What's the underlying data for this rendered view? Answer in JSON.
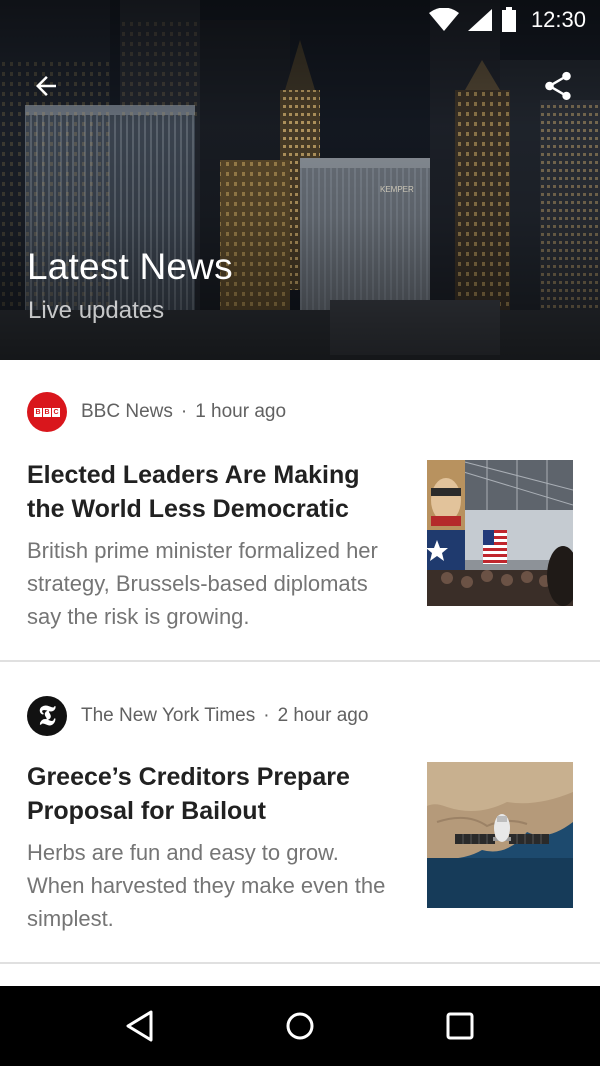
{
  "status_bar": {
    "time": "12:30",
    "icons": [
      "wifi-icon",
      "cellular-signal-icon",
      "battery-icon"
    ]
  },
  "header": {
    "back_icon": "arrow-left-icon",
    "share_icon": "share-icon",
    "title": "Latest News",
    "subtitle": "Live updates"
  },
  "articles": [
    {
      "source": "BBC News",
      "separator": "·",
      "time": "1 hour ago",
      "logo_icon": "bbc-logo-icon",
      "logo_color": "#d9161c",
      "title": "Elected Leaders Are Making the World Less Democratic",
      "summary": "British prime minister formalized her strategy, Brussels-based diplomats say the risk is growing.",
      "thumbnail": "rally-with-american-flag-image"
    },
    {
      "source": "The New York Times",
      "separator": "·",
      "time": "2 hour ago",
      "logo_icon": "nyt-logo-icon",
      "logo_color": "#111111",
      "title": "Greece’s Creditors Prepare Proposal for Bailout",
      "summary": "Herbs are fun and easy to grow. When harvested they make even the simplest.",
      "thumbnail": "satellite-over-earth-image"
    }
  ],
  "nav_bar": {
    "icons": [
      "back-triangle-icon",
      "home-circle-icon",
      "recents-square-icon"
    ]
  }
}
